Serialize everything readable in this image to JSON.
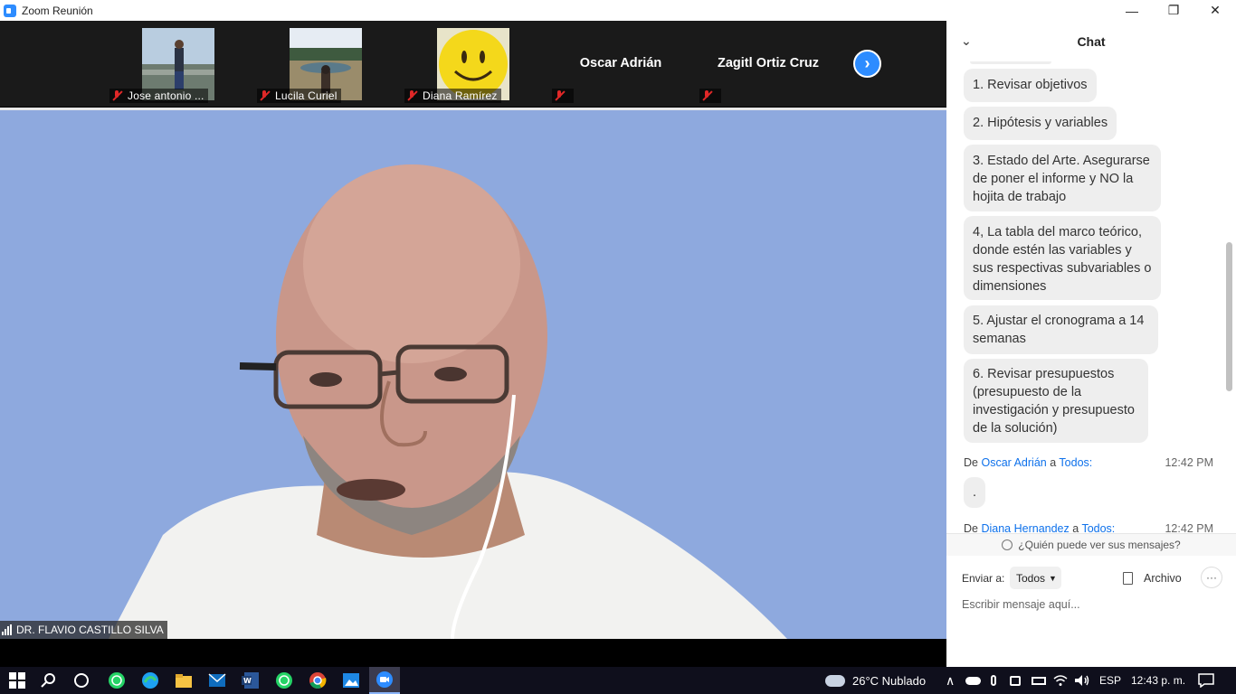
{
  "window": {
    "title": "Zoom Reunión",
    "controls": [
      "—",
      "❐",
      "✕"
    ]
  },
  "gallery": {
    "participants": [
      {
        "name": "Jose antonio ...",
        "has_video": true,
        "muted": true
      },
      {
        "name": "Lucila Curiel",
        "has_video": true,
        "muted": true
      },
      {
        "name": "Diana Ramírez",
        "has_video": true,
        "muted": true
      },
      {
        "name": "Oscar Adrián",
        "has_video": false,
        "muted": true
      },
      {
        "name": "Zagitl Ortiz Cruz",
        "has_video": false,
        "muted": true
      }
    ],
    "next_icon": "chevron-right-icon"
  },
  "main_video": {
    "speaker_name": "DR. FLAVIO CASTILLO SILVA",
    "background_color": "#8ea9de"
  },
  "chat": {
    "title": "Chat",
    "messages": [
      "1. Revisar objetivos",
      "2. Hipótesis y variables",
      "3. Estado del Arte. Asegurarse de poner el informe y NO la hojita de trabajo",
      "4, La tabla del marco  teórico, donde estén las variables y sus respectivas subvariables o dimensiones",
      "5. Ajustar el cronograma a 14 semanas",
      "6. Revisar presupuestos (presupuesto de la investigación y presupuesto de la solución)"
    ],
    "entries": [
      {
        "from_label": "De",
        "sender": "Oscar Adrián",
        "to_label": "a",
        "recipient": "Todos:",
        "time": "12:42 PM",
        "text": "."
      },
      {
        "from_label": "De",
        "sender": "Diana Hernandez",
        "to_label": "a",
        "recipient": "Todos:",
        "time": "12:42 PM"
      }
    ],
    "who_can_see": "¿Quién puede ver sus mensajes?",
    "send_to_label": "Enviar a:",
    "send_to_value": "Todos",
    "file_label": "Archivo",
    "more_label": "···",
    "input_placeholder": "Escribir mensaje aquí..."
  },
  "taskbar": {
    "weather": "26°C  Nublado",
    "language": "ESP",
    "time": "12:43 p. m.",
    "accent": "#2d8cff"
  }
}
